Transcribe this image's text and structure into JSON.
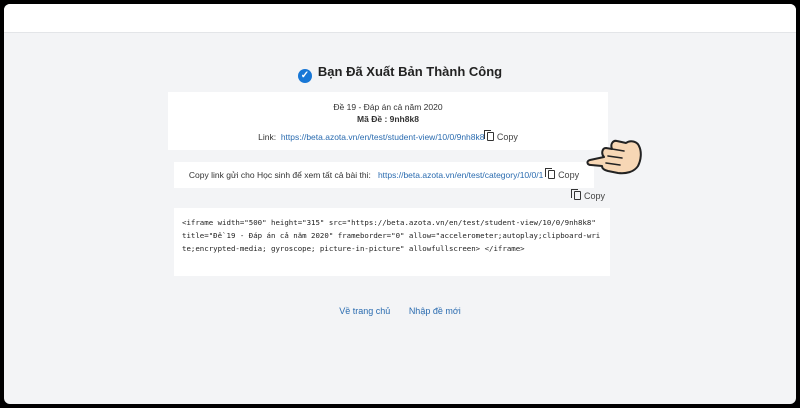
{
  "headline": {
    "title": "Bạn Đã Xuất Bản Thành Công"
  },
  "test_info": {
    "name": "Đề 19 - Đáp án cả năm 2020",
    "code": "Mã Đề : 9nh8k8",
    "link_label": "Link:",
    "link_url": "https://beta.azota.vn/en/test/student-view/10/0/9nh8k8",
    "copy_label": "Copy"
  },
  "student_link": {
    "label": "Copy link gửi cho Học sinh để xem tất cả bài thi:",
    "url": "https://beta.azota.vn/en/test/category/10/0/1",
    "copy_label": "Copy"
  },
  "embed": {
    "copy_label": "Copy",
    "code": "<iframe width=\"500\" height=\"315\" src=\"https://beta.azota.vn/en/test/student-view/10/0/9nh8k8\" title=\"Đề 19 - Đáp án cả năm 2020\" frameborder=\"0\" allow=\"accelerometer;autoplay;clipboard-write;encrypted-media; gyroscope; picture-in-picture\" allowfullscreen> </iframe>"
  },
  "footer": {
    "home_label": "Về trang chủ",
    "new_test_label": "Nhập đề mới"
  },
  "icons": {
    "success": "check-circle-icon",
    "copy": "clipboard-icon",
    "pointer": "pointing-hand-icon"
  },
  "colors": {
    "accent": "#1877d6",
    "link": "#2b6cb0"
  }
}
